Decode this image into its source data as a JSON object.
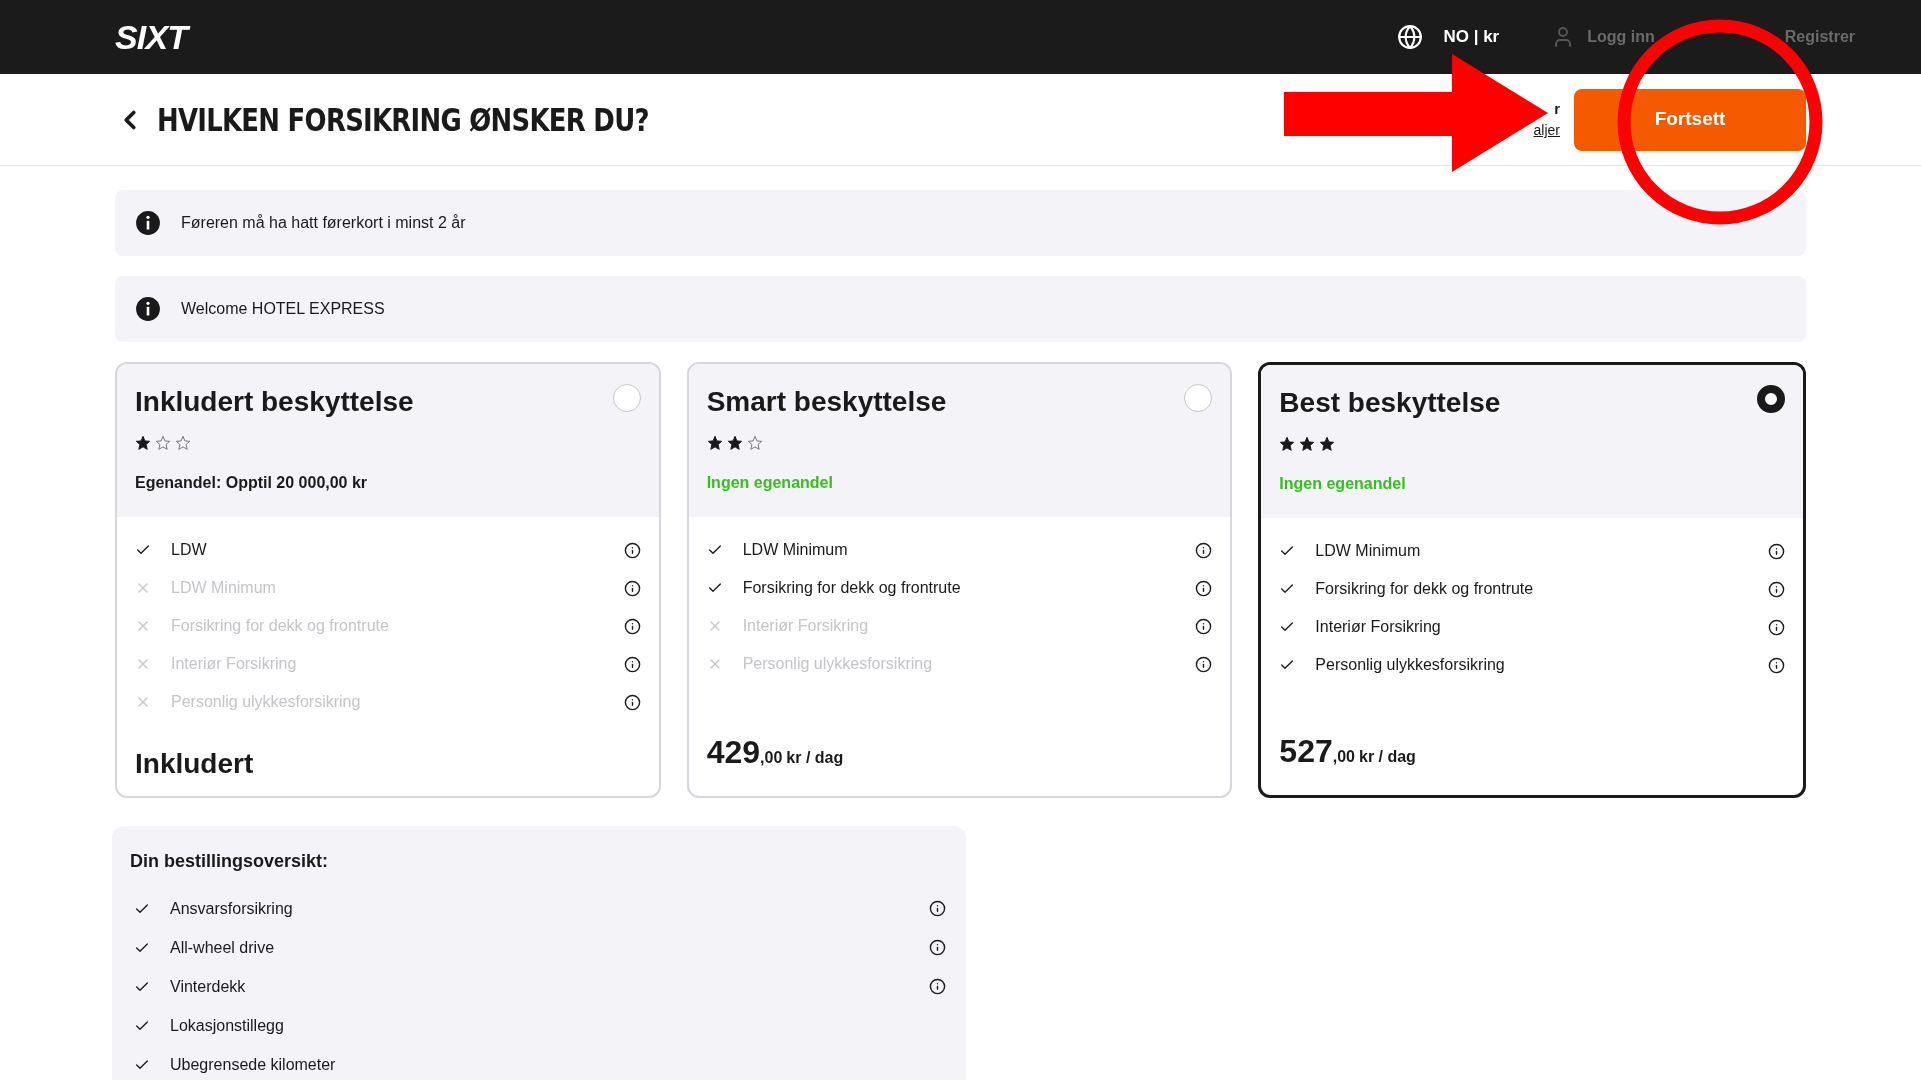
{
  "header": {
    "logo": "SIXT",
    "locale": "NO | kr",
    "login": "Logg inn",
    "register": "Registrer"
  },
  "title_bar": {
    "title": "HVILKEN FORSIKRING ØNSKER DU?",
    "price_fragment": "r",
    "details_fragment": "aljer",
    "continue_button": "Fortsett"
  },
  "notices": [
    "Føreren må ha hatt førerkort i minst 2 år",
    "Welcome HOTEL EXPRESS"
  ],
  "plans": [
    {
      "name": "Inkludert beskyttelse",
      "selected": false,
      "stars": 1,
      "deductible": "Egenandel: Opptil 20 000,00 kr",
      "deductible_highlighted": false,
      "features": [
        {
          "label": "LDW",
          "included": true
        },
        {
          "label": "LDW Minimum",
          "included": false
        },
        {
          "label": "Forsikring for dekk og frontrute",
          "included": false
        },
        {
          "label": "Interiør Forsikring",
          "included": false
        },
        {
          "label": "Personlig ulykkesforsikring",
          "included": false
        }
      ],
      "price": {
        "kind": "text",
        "text": "Inkludert"
      }
    },
    {
      "name": "Smart beskyttelse",
      "selected": false,
      "stars": 2,
      "deductible": "Ingen egenandel",
      "deductible_highlighted": true,
      "features": [
        {
          "label": "LDW Minimum",
          "included": true
        },
        {
          "label": "Forsikring for dekk og frontrute",
          "included": true
        },
        {
          "label": "Interiør Forsikring",
          "included": false
        },
        {
          "label": "Personlig ulykkesforsikring",
          "included": false
        }
      ],
      "price": {
        "kind": "amount",
        "whole": "429",
        "decimals": ",00",
        "unit": "kr / dag"
      }
    },
    {
      "name": "Best beskyttelse",
      "selected": true,
      "stars": 3,
      "deductible": "Ingen egenandel",
      "deductible_highlighted": true,
      "features": [
        {
          "label": "LDW Minimum",
          "included": true
        },
        {
          "label": "Forsikring for dekk og frontrute",
          "included": true
        },
        {
          "label": "Interiør Forsikring",
          "included": true
        },
        {
          "label": "Personlig ulykkesforsikring",
          "included": true
        }
      ],
      "price": {
        "kind": "amount",
        "whole": "527",
        "decimals": ",00",
        "unit": "kr / dag"
      }
    }
  ],
  "summary": {
    "title": "Din bestillingsoversikt:",
    "items": [
      {
        "label": "Ansvarsforsikring",
        "info": true
      },
      {
        "label": "All-wheel drive",
        "info": true
      },
      {
        "label": "Vinterdekk",
        "info": true
      },
      {
        "label": "Lokasjonstillegg",
        "info": false
      },
      {
        "label": "Ubegrensede kilometer",
        "info": false
      }
    ]
  }
}
